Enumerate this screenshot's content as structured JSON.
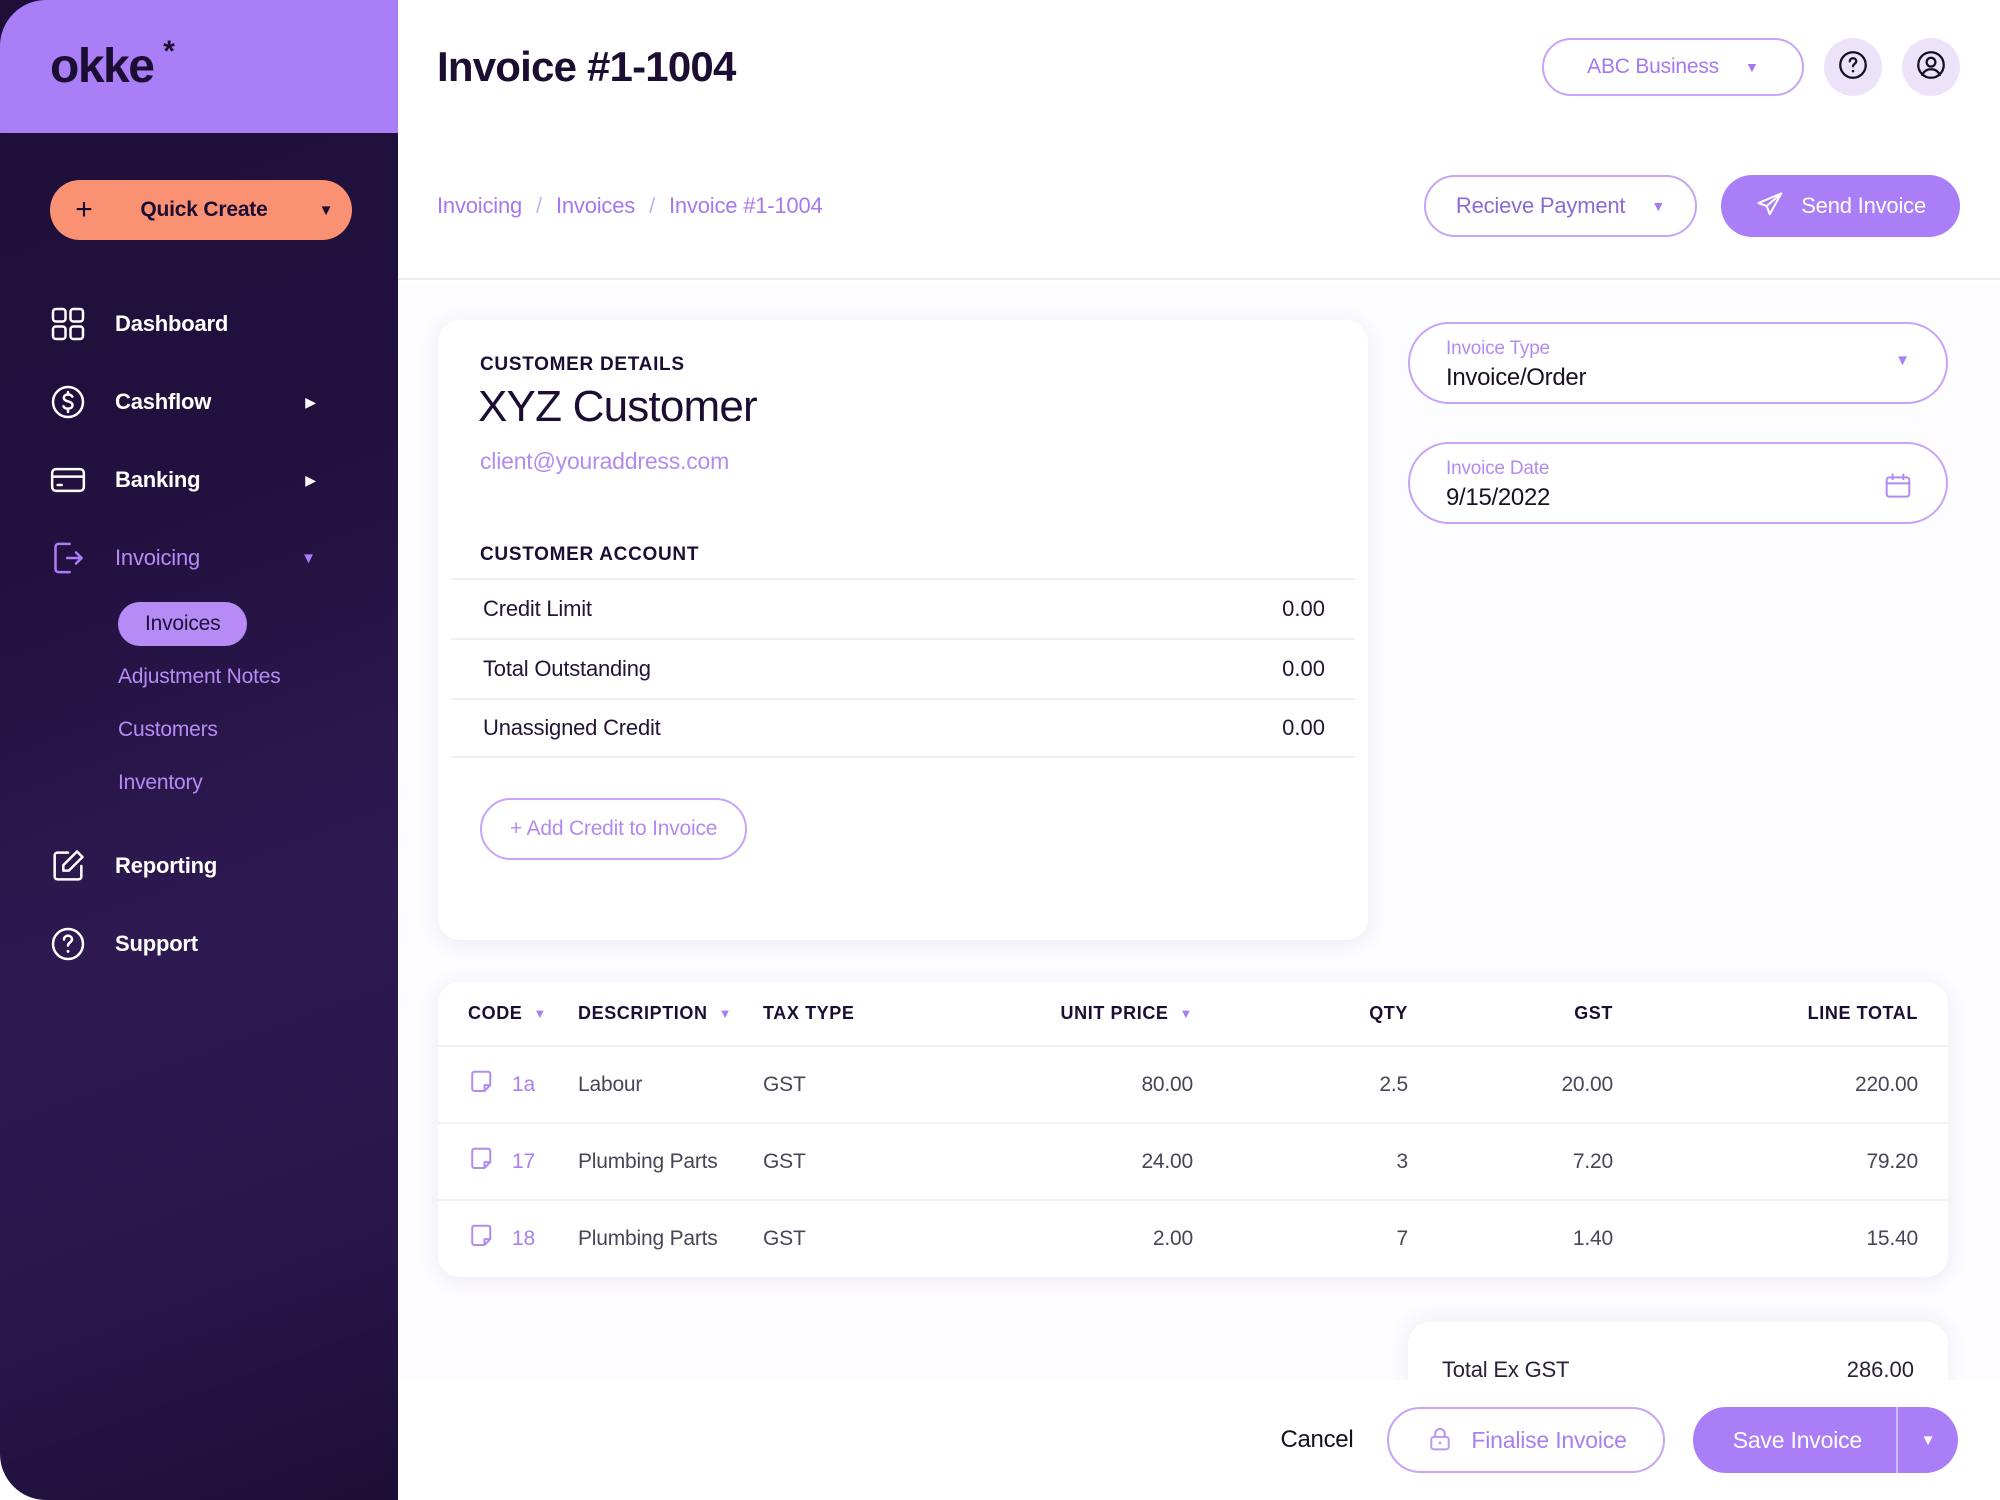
{
  "sidebar": {
    "logo": {
      "text": "okke",
      "star": "*"
    },
    "quick_create": {
      "plus": "+",
      "label": "Quick Create",
      "caret": "▼"
    },
    "items": [
      {
        "label": "Dashboard",
        "icon": "grid-icon",
        "caret": ""
      },
      {
        "label": "Cashflow",
        "icon": "dollar-circle-icon",
        "caret": "▶"
      },
      {
        "label": "Banking",
        "icon": "credit-card-icon",
        "caret": "▶"
      },
      {
        "label": "Invoicing",
        "icon": "exit-arrow-icon",
        "caret": "▼"
      }
    ],
    "subitems": [
      {
        "label": "Invoices",
        "active": true
      },
      {
        "label": "Adjustment Notes",
        "active": false
      },
      {
        "label": "Customers",
        "active": false
      },
      {
        "label": "Inventory",
        "active": false
      }
    ],
    "bottom_items": [
      {
        "label": "Reporting",
        "icon": "edit-square-icon"
      },
      {
        "label": "Support",
        "icon": "question-circle-icon"
      }
    ]
  },
  "header": {
    "title": "Invoice #1-1004",
    "org_switcher": {
      "label": "ABC Business",
      "caret": "▼"
    },
    "help_icon": "question-mark-icon",
    "account_icon": "user-avatar-icon"
  },
  "breadcrumb": {
    "items": [
      "Invoicing",
      "Invoices",
      "Invoice #1-1004"
    ],
    "separator": "/"
  },
  "subbar_actions": {
    "receive_payment": {
      "label": "Recieve Payment",
      "caret": "▼"
    },
    "send_invoice": {
      "label": "Send Invoice",
      "icon": "paper-plane-icon"
    }
  },
  "customer_card": {
    "details_label": "CUSTOMER DETAILS",
    "name": "XYZ Customer",
    "email": "client@youraddress.com",
    "account_label": "CUSTOMER ACCOUNT",
    "account_rows": [
      {
        "name": "Credit Limit",
        "value": "0.00"
      },
      {
        "name": "Total Outstanding",
        "value": "0.00"
      },
      {
        "name": "Unassigned Credit",
        "value": "0.00"
      }
    ],
    "add_credit_label": "+ Add Credit to Invoice"
  },
  "invoice_fields": {
    "type": {
      "label": "Invoice Type",
      "value": "Invoice/Order",
      "caret": "▼"
    },
    "date": {
      "label": "Invoice Date",
      "value": "9/15/2022",
      "icon": "calendar-icon"
    }
  },
  "line_items": {
    "columns": [
      {
        "key": "code",
        "label": "CODE",
        "sortable": true,
        "caret": "▼",
        "align": "left"
      },
      {
        "key": "desc",
        "label": "DESCRIPTION",
        "sortable": true,
        "caret": "▼",
        "align": "left"
      },
      {
        "key": "tax",
        "label": "TAX TYPE",
        "sortable": false,
        "caret": "",
        "align": "left"
      },
      {
        "key": "price",
        "label": "UNIT PRICE",
        "sortable": true,
        "caret": "▼",
        "align": "right"
      },
      {
        "key": "qty",
        "label": "QTY",
        "sortable": false,
        "caret": "",
        "align": "right"
      },
      {
        "key": "gst",
        "label": "GST",
        "sortable": false,
        "caret": "",
        "align": "right"
      },
      {
        "key": "total",
        "label": "LINE TOTAL",
        "sortable": false,
        "caret": "",
        "align": "right"
      }
    ],
    "rows": [
      {
        "icon": "note-icon",
        "code": "1a",
        "desc": "Labour",
        "tax": "GST",
        "price": "80.00",
        "qty": "2.5",
        "gst": "20.00",
        "total": "220.00"
      },
      {
        "icon": "note-icon",
        "code": "17",
        "desc": "Plumbing Parts",
        "tax": "GST",
        "price": "24.00",
        "qty": "3",
        "gst": "7.20",
        "total": "79.20"
      },
      {
        "icon": "note-icon",
        "code": "18",
        "desc": "Plumbing Parts",
        "tax": "GST",
        "price": "2.00",
        "qty": "7",
        "gst": "1.40",
        "total": "15.40"
      }
    ]
  },
  "totals": [
    {
      "name": "Total Ex GST",
      "value": "286.00"
    }
  ],
  "footer": {
    "cancel": "Cancel",
    "finalise": {
      "label": "Finalise Invoice",
      "icon": "lock-icon"
    },
    "save": {
      "label": "Save Invoice",
      "caret": "▼"
    }
  },
  "colors": {
    "brand_purple": "#a97ef7",
    "sidebar_dark": "#22113f",
    "accent_orange": "#fb9173",
    "light_purple": "#b68bf5"
  }
}
